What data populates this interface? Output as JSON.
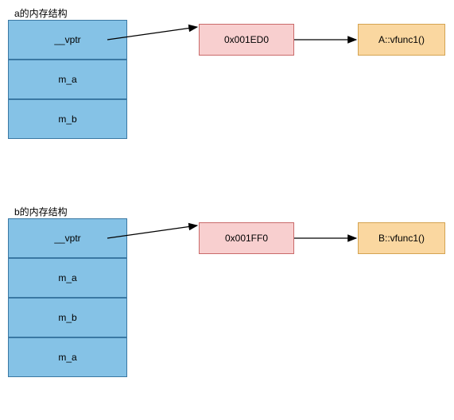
{
  "a": {
    "title": "a的内存结构",
    "cells": [
      "__vptr",
      "m_a",
      "m_b"
    ],
    "vptr_value": "0x001ED0",
    "vfunc": "A::vfunc1()"
  },
  "b": {
    "title": "b的内存结构",
    "cells": [
      "__vptr",
      "m_a",
      "m_b",
      "m_a"
    ],
    "vptr_value": "0x001FF0",
    "vfunc": "B::vfunc1()"
  }
}
